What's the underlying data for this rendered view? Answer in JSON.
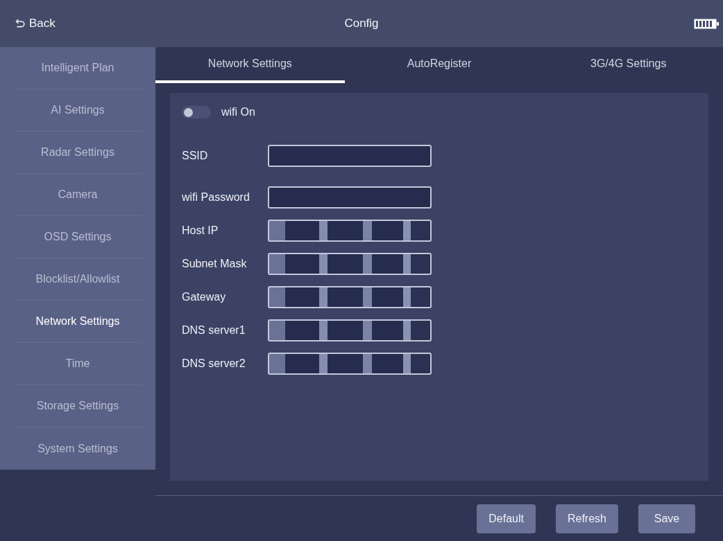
{
  "header": {
    "back_label": "Back",
    "title": "Config"
  },
  "sidebar": {
    "items": [
      {
        "label": "Intelligent Plan",
        "selected": false
      },
      {
        "label": "AI Settings",
        "selected": false
      },
      {
        "label": "Radar Settings",
        "selected": false
      },
      {
        "label": "Camera",
        "selected": false
      },
      {
        "label": "OSD Settings",
        "selected": false
      },
      {
        "label": "Blocklist/Allowlist",
        "selected": false
      },
      {
        "label": "Network Settings",
        "selected": true
      },
      {
        "label": "Time",
        "selected": false
      },
      {
        "label": "Storage Settings",
        "selected": false
      },
      {
        "label": "System Settings",
        "selected": false
      }
    ]
  },
  "tabs": [
    {
      "label": "Network Settings",
      "selected": true
    },
    {
      "label": "AutoRegister",
      "selected": false
    },
    {
      "label": "3G/4G Settings",
      "selected": false
    }
  ],
  "form": {
    "wifi_toggle": {
      "label": "wifi On",
      "on": false
    },
    "fields": [
      {
        "label": "SSID",
        "redacted": false
      },
      {
        "label": "wifi Password",
        "redacted": false
      },
      {
        "label": "Host IP",
        "redacted": true
      },
      {
        "label": "Subnet Mask",
        "redacted": true
      },
      {
        "label": "Gateway",
        "redacted": true
      },
      {
        "label": "DNS server1",
        "redacted": true
      },
      {
        "label": "DNS server2",
        "redacted": true
      }
    ]
  },
  "buttons": [
    "Default",
    "Refresh",
    "Save"
  ]
}
